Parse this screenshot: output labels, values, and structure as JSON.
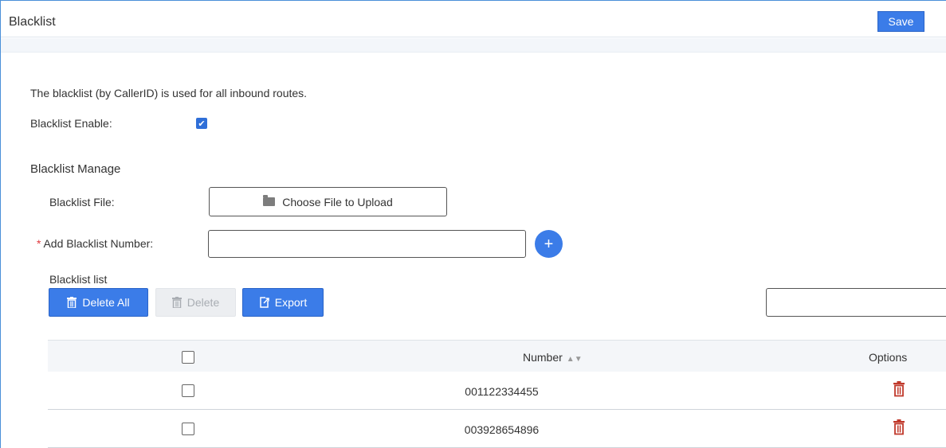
{
  "header": {
    "title": "Blacklist",
    "save_label": "Save"
  },
  "settings": {
    "description": "The blacklist (by CallerID) is used for all inbound routes.",
    "enable_label": "Blacklist Enable:",
    "enable_checked": true,
    "check_glyph": "✔"
  },
  "manage": {
    "section_title": "Blacklist Manage",
    "file_label": "Blacklist File:",
    "upload_label": "Choose File to Upload",
    "required_mark": "*",
    "add_label": "Add Blacklist Number:",
    "add_value": "",
    "plus_glyph": "+"
  },
  "list": {
    "label": "Blacklist list",
    "delete_all_label": "Delete All",
    "delete_label": "Delete",
    "export_label": "Export",
    "search_value": "",
    "columns": {
      "number": "Number",
      "options": "Options"
    },
    "rows": [
      {
        "number": "001122334455"
      },
      {
        "number": "003928654896"
      }
    ]
  },
  "colors": {
    "primary": "#3b7ce8",
    "danger": "#c0392b",
    "disabled_bg": "#eceef1"
  }
}
